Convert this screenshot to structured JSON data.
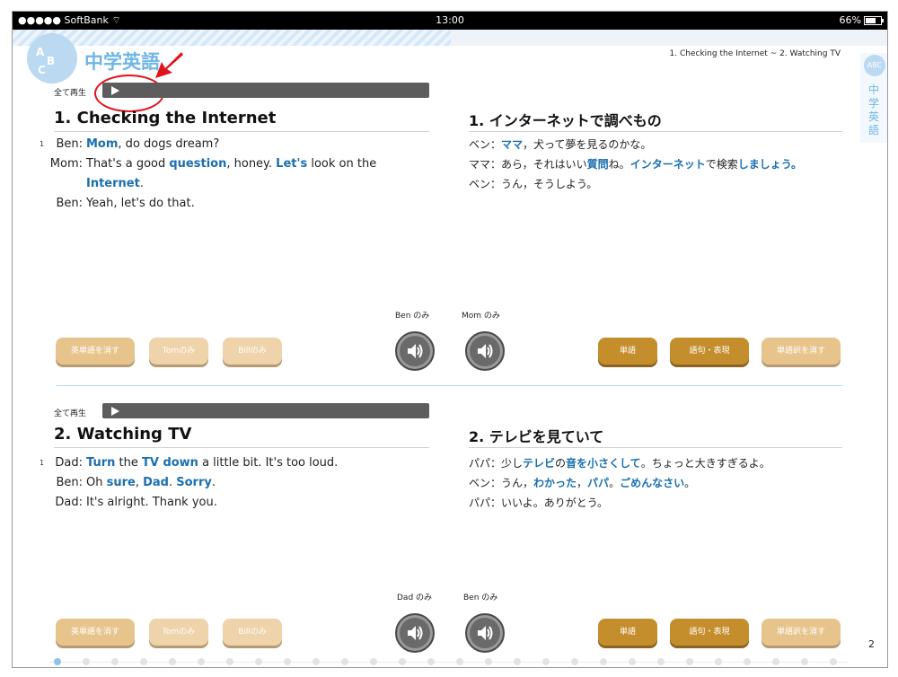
{
  "status": {
    "carrier": "●●●●● SoftBank",
    "wifi": "wifi-icon",
    "time": "13:00",
    "battery": "66%"
  },
  "header": {
    "brand": "中学英語",
    "page_range": "1. Checking the Internet ~ 2. Watching TV",
    "side_tab": "中学英語",
    "logo_letters": [
      "A",
      "B",
      "C"
    ]
  },
  "sections": [
    {
      "play_all": "全て再生",
      "title_en": "1. Checking the Internet",
      "title_jp": "1. インターネットで調べもの",
      "line_no": "1",
      "speakers": [
        "Ben:",
        "Mom:",
        "",
        "Ben:"
      ],
      "en_lines": [
        {
          "parts": [
            {
              "t": "Mom",
              "hl": true
            },
            {
              "t": ", do dogs dream?",
              "hl": false
            }
          ]
        },
        {
          "parts": [
            {
              "t": "That's a good ",
              "hl": false
            },
            {
              "t": "question",
              "hl": true
            },
            {
              "t": ", honey.  ",
              "hl": false
            },
            {
              "t": "Let's",
              "hl": true
            },
            {
              "t": " look on the",
              "hl": false
            }
          ]
        },
        {
          "parts": [
            {
              "t": "Internet",
              "hl": true
            },
            {
              "t": ".",
              "hl": false
            }
          ]
        },
        {
          "parts": [
            {
              "t": "Yeah, let's do that.",
              "hl": false
            }
          ]
        }
      ],
      "jp_lines": [
        {
          "parts": [
            {
              "t": "ベン：",
              "hl": false
            },
            {
              "t": "ママ",
              "hl": true
            },
            {
              "t": "，犬って夢を見るのかな。",
              "hl": false
            }
          ]
        },
        {
          "parts": [
            {
              "t": "ママ：あら，それはいい",
              "hl": false
            },
            {
              "t": "質問",
              "hl": true
            },
            {
              "t": "ね。",
              "hl": false
            },
            {
              "t": "インターネット",
              "hl": true
            },
            {
              "t": "で検索",
              "hl": false
            },
            {
              "t": "しましょう。",
              "hl": true
            }
          ]
        },
        {
          "parts": [
            {
              "t": "ベン：うん，そうしよう。",
              "hl": false
            }
          ]
        }
      ],
      "only_labels": [
        "Ben のみ",
        "Mom のみ"
      ],
      "buttons_left": [
        "英単語を消す",
        "Tomのみ",
        "Billのみ"
      ],
      "buttons_right": [
        "単語",
        "語句・表現",
        "単語訳を消す"
      ]
    },
    {
      "play_all": "全て再生",
      "title_en": "2. Watching TV",
      "title_jp": "2. テレビを見ていて",
      "line_no": "1",
      "speakers": [
        "Dad:",
        "Ben:",
        "Dad:"
      ],
      "en_lines": [
        {
          "parts": [
            {
              "t": "Turn",
              "hl": true
            },
            {
              "t": " the ",
              "hl": false
            },
            {
              "t": "TV down",
              "hl": true
            },
            {
              "t": " a little bit.  It's too loud.",
              "hl": false
            }
          ]
        },
        {
          "parts": [
            {
              "t": "Oh ",
              "hl": false
            },
            {
              "t": "sure",
              "hl": true
            },
            {
              "t": ", ",
              "hl": false
            },
            {
              "t": "Dad",
              "hl": true
            },
            {
              "t": ".  ",
              "hl": false
            },
            {
              "t": "Sorry",
              "hl": true
            },
            {
              "t": ".",
              "hl": false
            }
          ]
        },
        {
          "parts": [
            {
              "t": "It's alright.  Thank you.",
              "hl": false
            }
          ]
        }
      ],
      "jp_lines": [
        {
          "parts": [
            {
              "t": "パパ：少し",
              "hl": false
            },
            {
              "t": "テレビ",
              "hl": true
            },
            {
              "t": "の",
              "hl": false
            },
            {
              "t": "音を小さくして",
              "hl": true
            },
            {
              "t": "。ちょっと大きすぎるよ。",
              "hl": false
            }
          ]
        },
        {
          "parts": [
            {
              "t": "ベン：うん，",
              "hl": false
            },
            {
              "t": "わかった",
              "hl": true
            },
            {
              "t": "，",
              "hl": false
            },
            {
              "t": "パパ",
              "hl": true
            },
            {
              "t": "。",
              "hl": false
            },
            {
              "t": "ごめんなさい",
              "hl": true
            },
            {
              "t": "。",
              "hl": false
            }
          ]
        },
        {
          "parts": [
            {
              "t": "パパ：いいよ。ありがとう。",
              "hl": false
            }
          ]
        }
      ],
      "only_labels": [
        "Dad のみ",
        "Ben のみ"
      ],
      "buttons_left": [
        "英単語を消す",
        "Tomのみ",
        "Billのみ"
      ],
      "buttons_right": [
        "単語",
        "語句・表現",
        "単語訳を消す"
      ]
    }
  ],
  "page_number": "2",
  "colors": {
    "highlight": "#1a6fb0",
    "brand": "#6fb5e6",
    "btn_light": "#e8c48d",
    "btn_dark": "#c58e2c",
    "annotation": "#e0141e"
  }
}
